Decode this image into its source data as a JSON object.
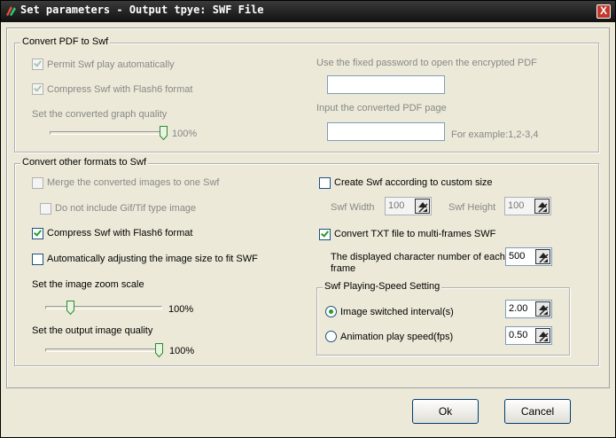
{
  "window": {
    "title": "Set parameters - Output tpye: SWF File",
    "close_label": "X"
  },
  "pdf_group": {
    "title": "Convert PDF to Swf",
    "permit_play_label": "Permit Swf play automatically",
    "permit_play_checked": true,
    "compress_label": "Compress Swf with Flash6 format",
    "compress_checked": true,
    "quality_label": "Set the converted graph quality",
    "quality_value": "100%",
    "quality_level": 1.0,
    "password_label": "Use the fixed password to open the encrypted PDF",
    "password_value": "",
    "page_label": "Input the converted PDF page",
    "page_value": "",
    "page_hint": "For example:1,2-3,4"
  },
  "other_group": {
    "title": "Convert other formats to Swf",
    "merge_label": "Merge the converted images to one Swf",
    "merge_checked": false,
    "exclude_gif_label": "Do not include Gif/Tif type image",
    "exclude_gif_checked": false,
    "compress_label": "Compress Swf with Flash6 format",
    "compress_checked": true,
    "auto_adjust_label": "Automatically adjusting the image size to fit SWF",
    "auto_adjust_checked": false,
    "zoom_label": "Set the image zoom scale",
    "zoom_value": "100%",
    "zoom_level": 0.2,
    "output_quality_label": "Set the output image quality",
    "output_quality_value": "100%",
    "output_quality_level": 1.0,
    "custom_size_label": "Create Swf according to custom size",
    "custom_size_checked": false,
    "width_label": "Swf Width",
    "width_value": "100",
    "height_label": "Swf Height",
    "height_value": "100",
    "txt_multi_label": "Convert TXT file to multi-frames SWF",
    "txt_multi_checked": true,
    "char_number_label_1": "The displayed character number of each",
    "char_number_label_2": "frame",
    "char_number_value": "500"
  },
  "speed_group": {
    "title": "Swf Playing-Speed Setting",
    "interval_label": "Image switched interval(s)",
    "interval_selected": true,
    "interval_value": "2.00",
    "fps_label": "Animation play speed(fps)",
    "fps_selected": false,
    "fps_value": "0.50"
  },
  "buttons": {
    "ok_label": "Ok",
    "cancel_label": "Cancel"
  },
  "colors": {
    "accent_check": "#21a121",
    "title_bar": "#1a1a1a",
    "dialog_bg": "#ece9d8"
  }
}
